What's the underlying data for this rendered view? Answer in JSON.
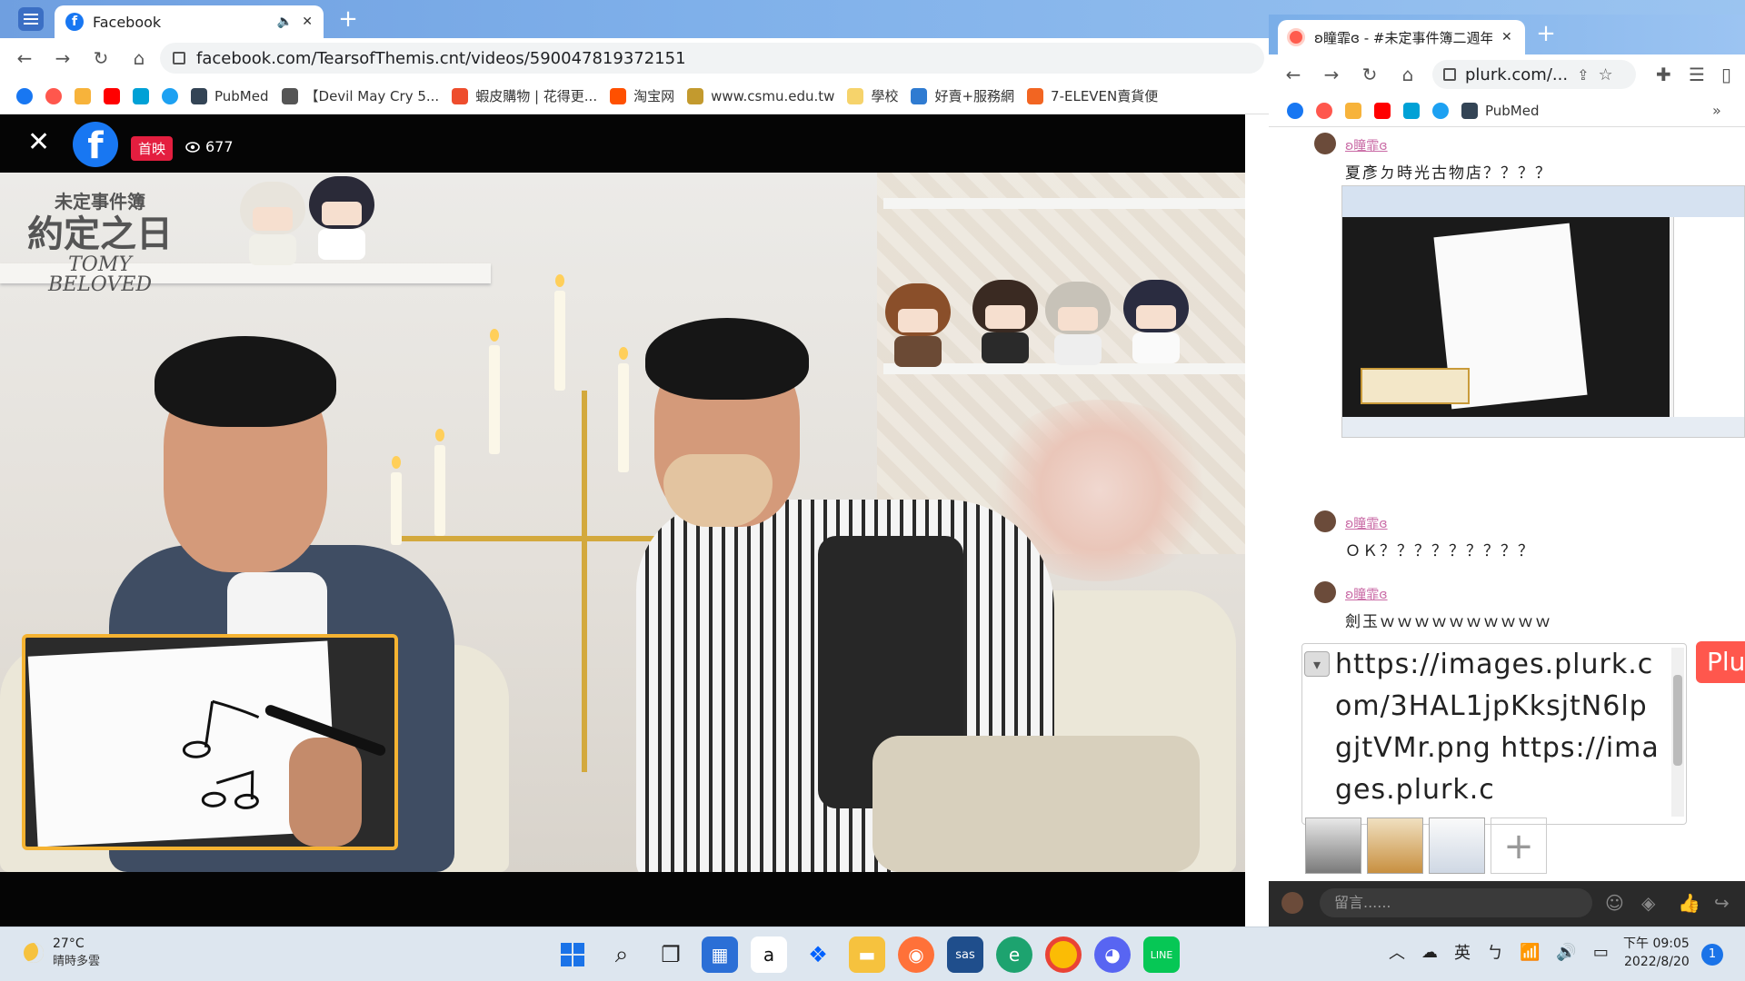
{
  "main_browser": {
    "tab_title": "Facebook",
    "url": "facebook.com/TearsofThemis.cnt/videos/590047819372151",
    "bookmarks": [
      "PubMed",
      "【Devil May Cry 5...",
      "蝦皮購物 | 花得更...",
      "淘宝网",
      "www.csmu.edu.tw",
      "學校",
      "好賣+服務網",
      "7-ELEVEN賣貨便"
    ]
  },
  "video": {
    "premiere_badge": "首映",
    "viewer_count": "677",
    "logo_line1": "未定事件簿",
    "logo_line2": "約定之日",
    "logo_line3": "TOMY",
    "logo_line4": "BELOVED"
  },
  "plurk_browser": {
    "tab_title": "ʚ瞳霏ɞ - #未定事件簿二週年",
    "url": "plurk.com/...",
    "bookmarks": [
      "PubMed"
    ],
    "posts": [
      {
        "nick": "ʚ瞳霏ɞ",
        "text": "夏彥ㄉ時光古物店？？？？"
      },
      {
        "nick": "ʚ瞳霏ɞ",
        "text": "ＯＫ？？？？？？？？？"
      },
      {
        "nick": "ʚ瞳霏ɞ",
        "text": "劍玉ｗｗｗｗｗｗｗｗｗｗ"
      }
    ],
    "editor_text": "https://images.plurk.com/3HAL1jpKksjtN6lpgjtVMr.png https://images.plurk.c",
    "plurk_button": "Plu",
    "comment_placeholder": "留言......"
  },
  "taskbar": {
    "temperature": "27°C",
    "condition": "晴時多雲",
    "ime_lang": "英",
    "ime_mode": "ㄅ",
    "time": "下午 09:05",
    "date": "2022/8/20",
    "notification_count": "1"
  },
  "colors": {
    "facebook_blue": "#1877f2",
    "premiere_red": "#e41e3f",
    "pip_border": "#f5b332",
    "plurk_red": "#ff574d",
    "plurk_nick": "#c96aa5"
  }
}
